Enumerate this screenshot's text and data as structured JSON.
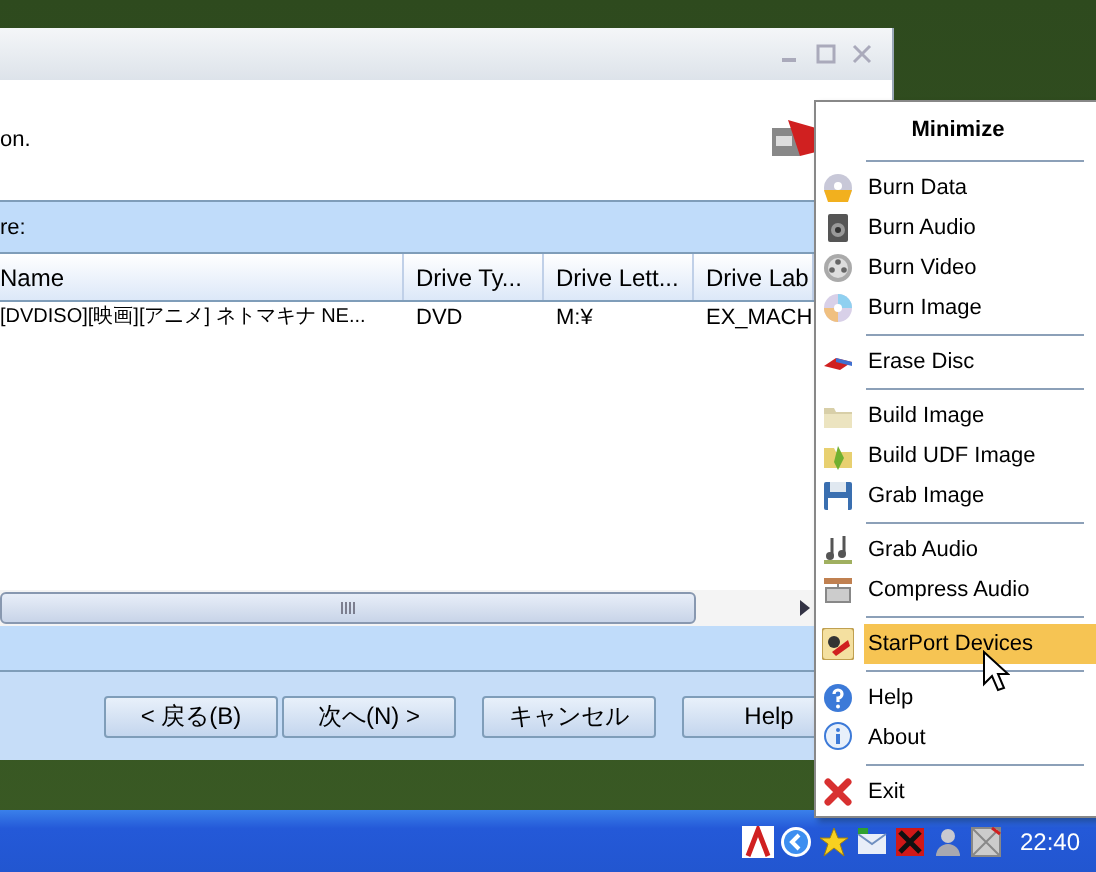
{
  "window": {
    "intro_text": "on.",
    "section_label": "re:",
    "table": {
      "columns": [
        "Name",
        "Drive Ty...",
        "Drive Lett...",
        "Drive Lab"
      ],
      "rows": [
        [
          "[DVDISO][映画][アニメ] ネトマキナ NE...",
          "DVD",
          "M:¥",
          "EX_MACH"
        ]
      ]
    },
    "buttons": [
      "< 戻る(B)",
      "次へ(N) >",
      "キャンセル",
      "Help"
    ]
  },
  "menu": [
    {
      "kind": "header",
      "label": "Minimize",
      "selected": false
    },
    {
      "kind": "separator"
    },
    {
      "kind": "item",
      "label": "Burn Data",
      "selected": false
    },
    {
      "kind": "item",
      "label": "Burn Audio",
      "selected": false
    },
    {
      "kind": "item",
      "label": "Burn Video",
      "selected": false
    },
    {
      "kind": "item",
      "label": "Burn Image",
      "selected": false
    },
    {
      "kind": "separator"
    },
    {
      "kind": "item",
      "label": "Erase Disc",
      "selected": false
    },
    {
      "kind": "separator"
    },
    {
      "kind": "item",
      "label": "Build Image",
      "selected": false
    },
    {
      "kind": "item",
      "label": "Build UDF Image",
      "selected": false
    },
    {
      "kind": "item",
      "label": "Grab Image",
      "selected": false
    },
    {
      "kind": "separator"
    },
    {
      "kind": "item",
      "label": "Grab Audio",
      "selected": false
    },
    {
      "kind": "item",
      "label": "Compress Audio",
      "selected": false
    },
    {
      "kind": "separator"
    },
    {
      "kind": "item",
      "label": "StarPort Devices",
      "selected": true
    },
    {
      "kind": "separator"
    },
    {
      "kind": "item",
      "label": "Help",
      "selected": false
    },
    {
      "kind": "item",
      "label": "About",
      "selected": false
    },
    {
      "kind": "separator"
    },
    {
      "kind": "item",
      "label": "Exit",
      "selected": false
    }
  ],
  "taskbar": {
    "clock": "22:40"
  }
}
